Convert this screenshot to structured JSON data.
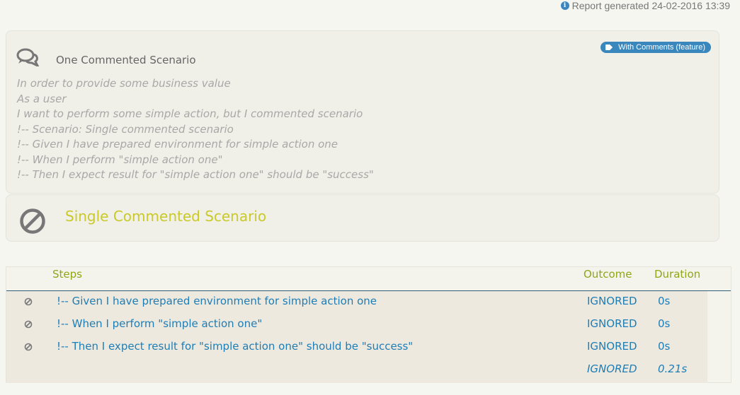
{
  "report": {
    "icon": "info-icon",
    "text": "Report generated 24-02-2016 13:39"
  },
  "feature": {
    "icon": "comments-icon",
    "title": "One Commented Scenario",
    "tag": "With Comments (feature)",
    "tag_icon": "tag-icon",
    "tag_color": "#3a87bd",
    "description": [
      "In order to provide some business value",
      "As a user",
      "I want to perform some simple action, but I commented scenario",
      "!-- Scenario: Single commented scenario",
      "!-- Given I have prepared environment for simple action one",
      "!-- When I perform \"simple action one\"",
      "!-- Then I expect result for \"simple action one\" should be \"success\""
    ]
  },
  "scenario": {
    "icon": "ban-icon",
    "title": "Single Commented Scenario"
  },
  "table": {
    "headers": {
      "steps": "Steps",
      "outcome": "Outcome",
      "duration": "Duration"
    },
    "rows": [
      {
        "icon": "ban-icon",
        "step": "!-- Given I have prepared environment for simple action one",
        "outcome": "IGNORED",
        "duration": "0s"
      },
      {
        "icon": "ban-icon",
        "step": "!-- When I perform \"simple action one\"",
        "outcome": "IGNORED",
        "duration": "0s"
      },
      {
        "icon": "ban-icon",
        "step": "!-- Then I expect result for \"simple action one\" should be \"success\"",
        "outcome": "IGNORED",
        "duration": "0s"
      }
    ],
    "total": {
      "outcome": "IGNORED",
      "duration": "0.21s"
    }
  }
}
